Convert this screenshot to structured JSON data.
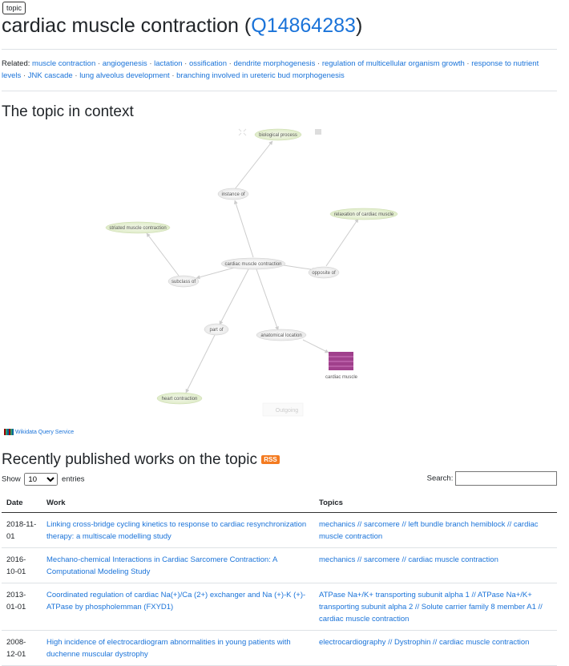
{
  "badge": "topic",
  "title": {
    "name": "cardiac muscle contraction",
    "qid": "Q14864283",
    "open": " (",
    "close": ")"
  },
  "related": {
    "label": "Related:",
    "items": [
      "muscle contraction",
      "angiogenesis",
      "lactation",
      "ossification",
      "dendrite morphogenesis",
      "regulation of multicellular organism growth",
      "response to nutrient levels",
      "JNK cascade",
      "lung alveolus development",
      "branching involved in ureteric bud morphogenesis"
    ]
  },
  "context_heading": "The topic in context",
  "graph": {
    "nodes": {
      "biological_process": "biological process",
      "instance_of": "instance of",
      "relaxation": "relaxation of cardiac muscle",
      "striated": "striated muscle contraction",
      "center": "cardiac muscle contraction",
      "opposite_of": "opposite of",
      "subclass_of": "subclass of",
      "part_of": "part of",
      "anatomical_location": "anatomical location",
      "cardiac_muscle": "cardiac muscle",
      "heart_contraction": "heart contraction"
    },
    "outgoing_button": "Outgoing"
  },
  "wikidata_query_service": "Wikidata Query Service",
  "works_heading": "Recently published works on the topic",
  "rss_label": "RSS",
  "table_controls": {
    "show": "Show",
    "entries": "entries",
    "page_size": "10",
    "search_label": "Search:"
  },
  "table": {
    "headers": {
      "date": "Date",
      "work": "Work",
      "topics": "Topics"
    },
    "rows": [
      {
        "date": "2018-11-01",
        "work": "Linking cross-bridge cycling kinetics to response to cardiac resynchronization therapy: a multiscale modelling study",
        "topics": "mechanics // sarcomere // left bundle branch hemiblock // cardiac muscle contraction"
      },
      {
        "date": "2016-10-01",
        "work": "Mechano-chemical Interactions in Cardiac Sarcomere Contraction: A Computational Modeling Study",
        "topics": "mechanics // sarcomere // cardiac muscle contraction"
      },
      {
        "date": "2013-01-01",
        "work": "Coordinated regulation of cardiac Na(+)/Ca (2+) exchanger and Na (+)-K (+)-ATPase by phospholemman (FXYD1)",
        "topics": "ATPase Na+/K+ transporting subunit alpha 1 // ATPase Na+/K+ transporting subunit alpha 2 // Solute carrier family 8 member A1 // cardiac muscle contraction"
      },
      {
        "date": "2008-12-01",
        "work": "High incidence of electrocardiogram abnormalities in young patients with duchenne muscular dystrophy",
        "topics": "electrocardiography // Dystrophin // cardiac muscle contraction"
      }
    ]
  }
}
